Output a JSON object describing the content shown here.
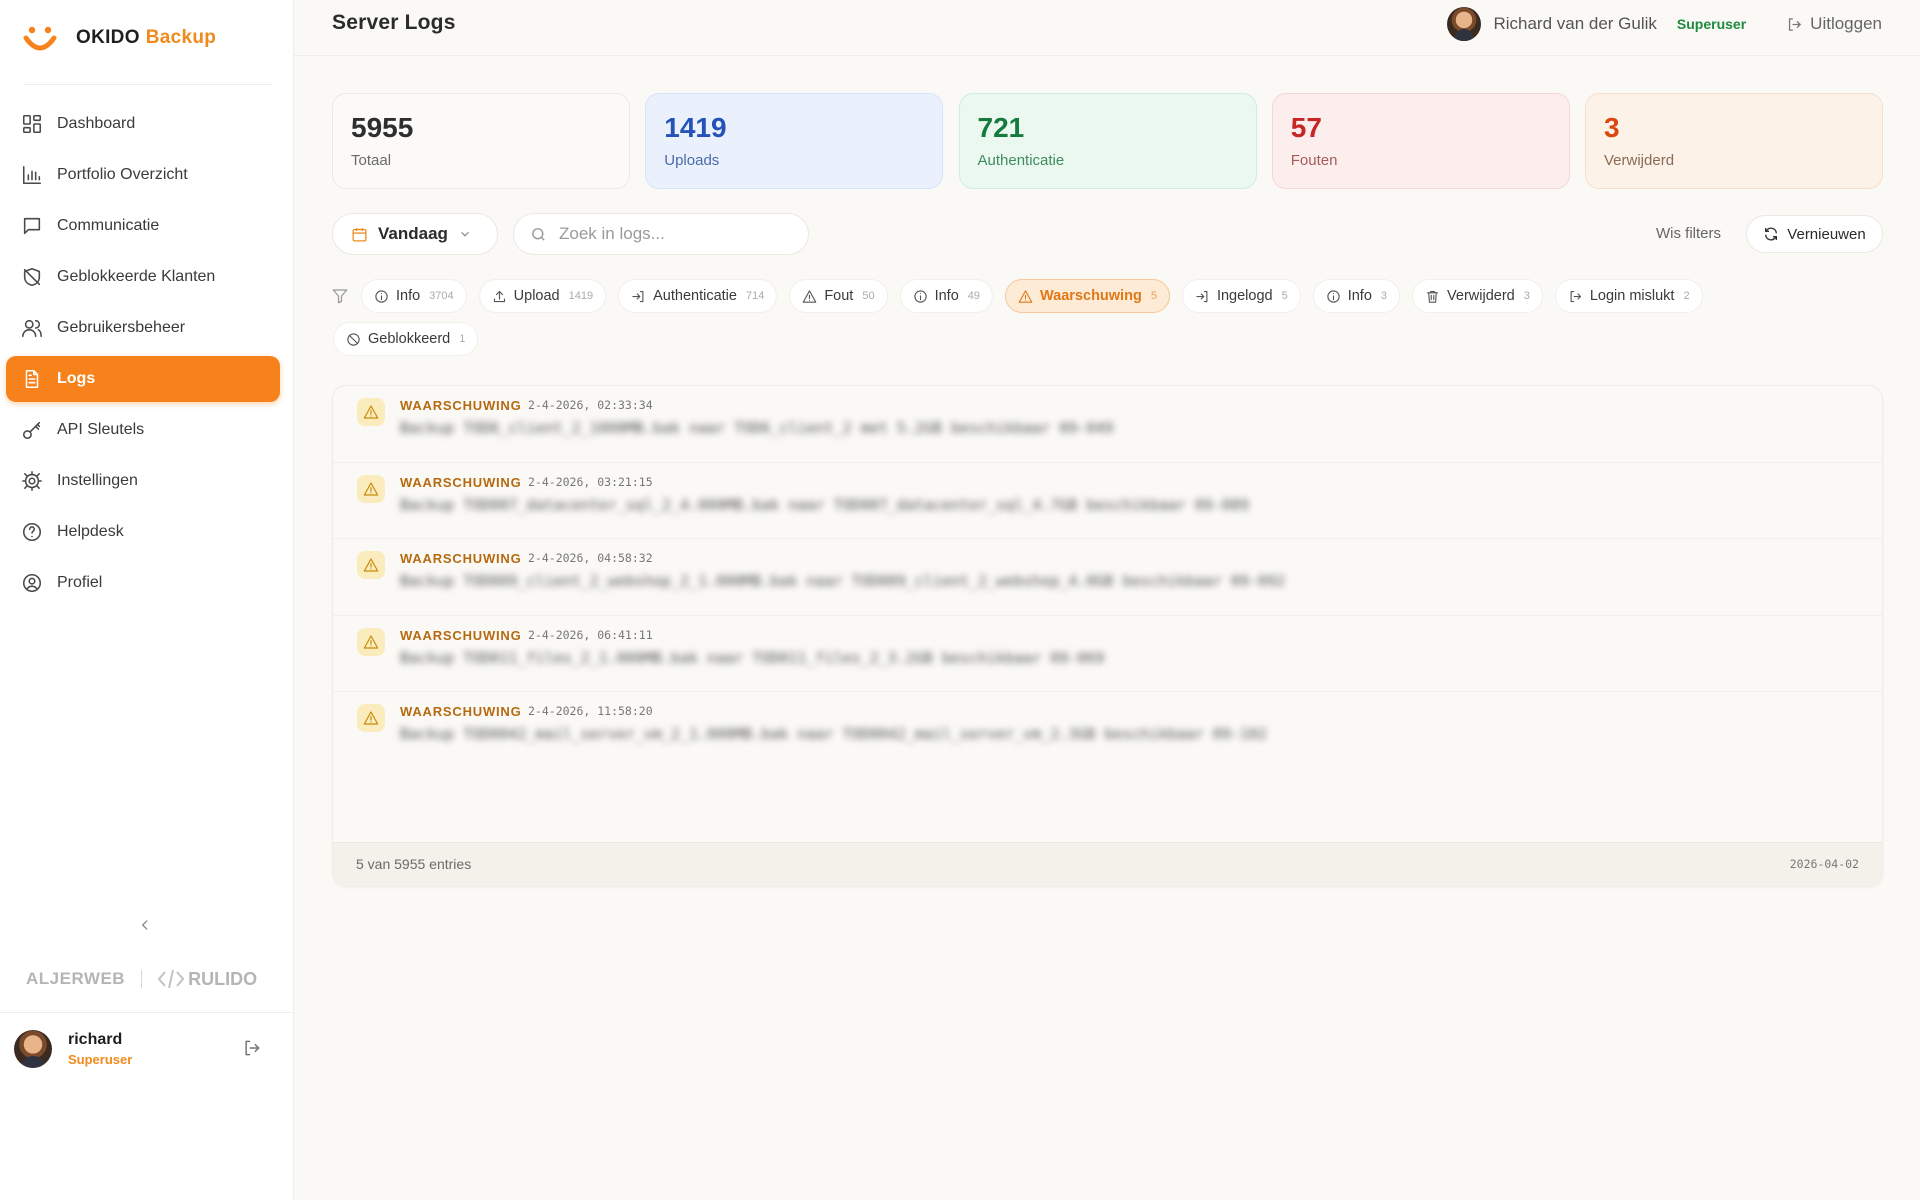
{
  "brand": {
    "name": "OKIDO",
    "accent": "Backup"
  },
  "nav": {
    "items": [
      {
        "label": "Dashboard",
        "icon": "grid-icon"
      },
      {
        "label": "Portfolio Overzicht",
        "icon": "bar-chart-icon"
      },
      {
        "label": "Communicatie",
        "icon": "message-icon"
      },
      {
        "label": "Geblokkeerde Klanten",
        "icon": "shield-off-icon"
      },
      {
        "label": "Gebruikersbeheer",
        "icon": "users-icon"
      },
      {
        "label": "Logs",
        "icon": "file-text-icon",
        "active": true
      },
      {
        "label": "API Sleutels",
        "icon": "key-icon"
      },
      {
        "label": "Instellingen",
        "icon": "gear-icon"
      },
      {
        "label": "Helpdesk",
        "icon": "help-circle-icon"
      },
      {
        "label": "Profiel",
        "icon": "user-circle-icon"
      }
    ]
  },
  "partners": {
    "left": "ALJERWEB",
    "right": "RULIDO"
  },
  "sidebar_user": {
    "name": "richard",
    "role": "Superuser"
  },
  "header": {
    "title": "Server Logs",
    "user_name": "Richard van der Gulik",
    "user_role": "Superuser",
    "logout_label": "Uitloggen"
  },
  "stats": [
    {
      "value": "5955",
      "label": "Totaal"
    },
    {
      "value": "1419",
      "label": "Uploads"
    },
    {
      "value": "721",
      "label": "Authenticatie"
    },
    {
      "value": "57",
      "label": "Fouten"
    },
    {
      "value": "3",
      "label": "Verwijderd"
    }
  ],
  "filters": {
    "date_value": "Vandaag",
    "search_placeholder": "Zoek in logs...",
    "clear_label": "Wis filters",
    "refresh_label": "Vernieuwen"
  },
  "chips": [
    {
      "label": "Info",
      "count": "3704",
      "icon": "info-icon"
    },
    {
      "label": "Upload",
      "count": "1419",
      "icon": "upload-icon"
    },
    {
      "label": "Authenticatie",
      "count": "714",
      "icon": "login-icon"
    },
    {
      "label": "Fout",
      "count": "50",
      "icon": "warning-icon"
    },
    {
      "label": "Info",
      "count": "49",
      "icon": "info-icon"
    },
    {
      "label": "Waarschuwing",
      "count": "5",
      "icon": "warning-icon",
      "active": true
    },
    {
      "label": "Ingelogd",
      "count": "5",
      "icon": "login-icon"
    },
    {
      "label": "Info",
      "count": "3",
      "icon": "info-icon"
    },
    {
      "label": "Verwijderd",
      "count": "3",
      "icon": "trash-icon"
    },
    {
      "label": "Login mislukt",
      "count": "2",
      "icon": "logout-icon"
    },
    {
      "label": "Geblokkeerd",
      "count": "1",
      "icon": "ban-icon"
    }
  ],
  "logs": [
    {
      "level": "WAARSCHUWING",
      "timestamp": "2-4-2026, 02:33:34",
      "message": "Backup TOD6_client_2_1000MB.bak naar TOD6_client_2 met 5.2GB beschikbaar 09-049"
    },
    {
      "level": "WAARSCHUWING",
      "timestamp": "2-4-2026, 03:21:15",
      "message": "Backup TOD007_datacenter_sql_2_4.000MB.bak naar TOD007_datacenter_sql_4.7GB beschikbaar 09-089"
    },
    {
      "level": "WAARSCHUWING",
      "timestamp": "2-4-2026, 04:58:32",
      "message": "Backup TOD009_client_2_webshop_2_1.000MB.bak naar TOD009_client_2_webshop_4.0GB beschikbaar 09-092"
    },
    {
      "level": "WAARSCHUWING",
      "timestamp": "2-4-2026, 06:41:11",
      "message": "Backup TOD011_files_2_1.000MB.bak naar TOD011_files_2_3.2GB beschikbaar 09-069"
    },
    {
      "level": "WAARSCHUWING",
      "timestamp": "2-4-2026, 11:58:20",
      "message": "Backup TOD0042_mail_server_vm_2_1.000MB.bak naar TOD0042_mail_server_vm_2.3GB beschikbaar 09-102"
    }
  ],
  "footer": {
    "count_text": "5 van 5955 entries",
    "date": "2026-04-02"
  },
  "colors": {
    "accent": "#f7821b",
    "warning": "#b66a10"
  }
}
